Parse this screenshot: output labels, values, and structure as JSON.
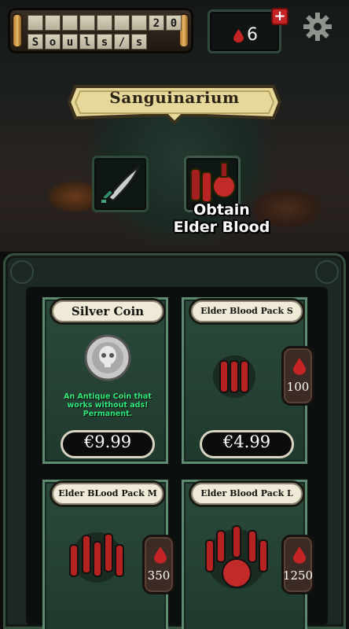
{
  "hud": {
    "counter_top": [
      "",
      "",
      "",
      "",
      "",
      "",
      "",
      "2",
      "0"
    ],
    "counter_bottom": [
      "S",
      "o",
      "u",
      "l",
      "s",
      "/",
      "s"
    ],
    "blood_count": "6",
    "plus_label": "+"
  },
  "banner": {
    "title": "Sanguinarium"
  },
  "slots": {
    "obtain_label_1": "Obtain",
    "obtain_label_2": "Elder Blood"
  },
  "shop": {
    "items": [
      {
        "title": "Silver Coin",
        "description": "An Antique Coin that works without ads! Permanent.",
        "price": "€9.99"
      },
      {
        "title": "Elder Blood Pack S",
        "price": "€4.99",
        "blood_amount": "100"
      },
      {
        "title": "Elder BLood Pack M",
        "blood_amount": "350"
      },
      {
        "title": "Elder Blood Pack L",
        "blood_amount": "1250"
      }
    ]
  },
  "colors": {
    "blood": "#c42424",
    "card_green": "#2b4a3a",
    "card_border": "#5e8a70",
    "desc_green": "#2eea7a",
    "plate": "#efe9d8"
  }
}
